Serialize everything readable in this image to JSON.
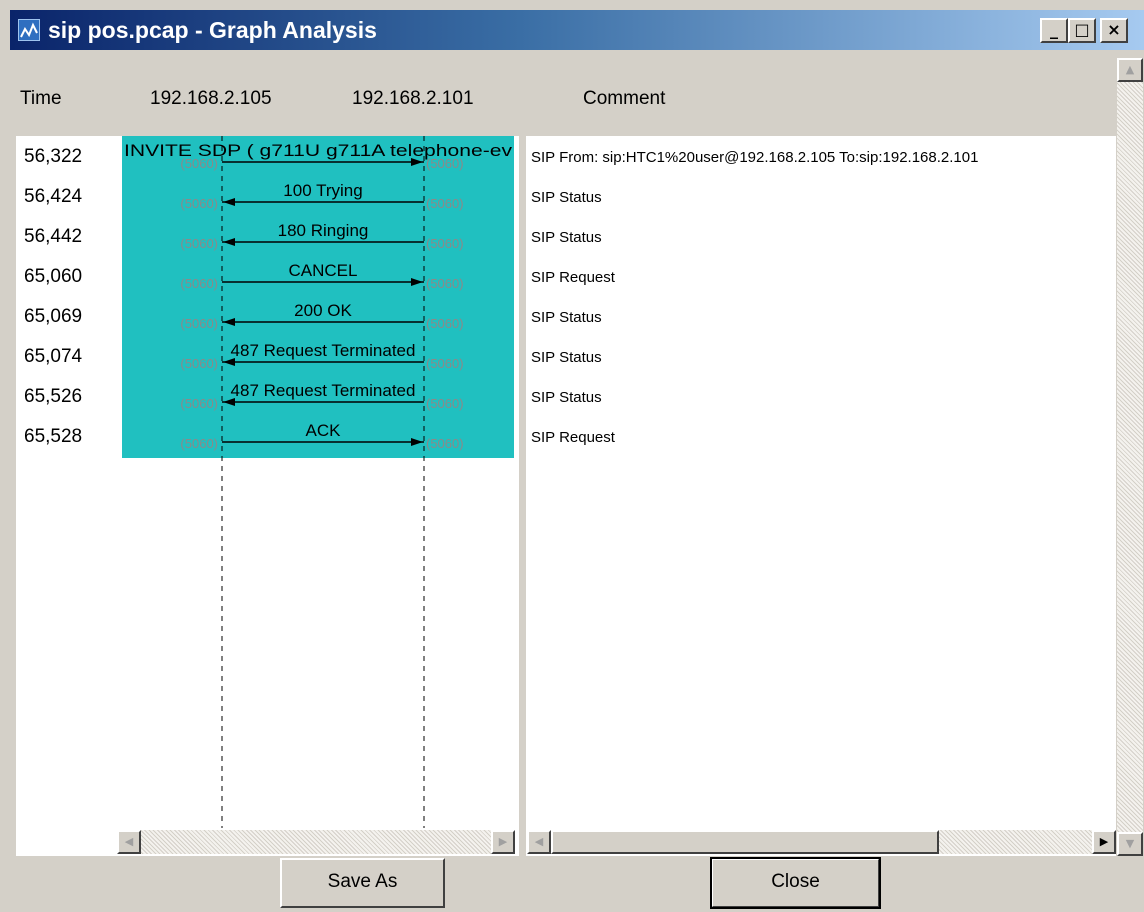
{
  "window": {
    "title": "sip pos.pcap - Graph Analysis",
    "controls": {
      "minimize": "_",
      "maximize": "□",
      "close": "×"
    }
  },
  "header": {
    "time": "Time",
    "host_a": "192.168.2.105",
    "host_b": "192.168.2.101",
    "comment": "Comment"
  },
  "colors": {
    "highlight": "#20c0c0",
    "titlebar": "#0a246a"
  },
  "rows": [
    {
      "time": "56,322",
      "label": "INVITE SDP ( g711U g711A telephone-ev",
      "direction": "right",
      "src_port": "(5060)",
      "dst_port": "(5060)",
      "comment": "SIP From: sip:HTC1%20user@192.168.2.105 To:sip:192.168.2.101"
    },
    {
      "time": "56,424",
      "label": "100 Trying",
      "direction": "left",
      "src_port": "(5060)",
      "dst_port": "(5060)",
      "comment": "SIP Status"
    },
    {
      "time": "56,442",
      "label": "180 Ringing",
      "direction": "left",
      "src_port": "(5060)",
      "dst_port": "(5060)",
      "comment": "SIP Status"
    },
    {
      "time": "65,060",
      "label": "CANCEL",
      "direction": "right",
      "src_port": "(5060)",
      "dst_port": "(5060)",
      "comment": "SIP Request"
    },
    {
      "time": "65,069",
      "label": "200 OK",
      "direction": "left",
      "src_port": "(5060)",
      "dst_port": "(5060)",
      "comment": "SIP Status"
    },
    {
      "time": "65,074",
      "label": "487 Request Terminated",
      "direction": "left",
      "src_port": "(5060)",
      "dst_port": "(5060)",
      "comment": "SIP Status"
    },
    {
      "time": "65,526",
      "label": "487 Request Terminated",
      "direction": "left",
      "src_port": "(5060)",
      "dst_port": "(5060)",
      "comment": "SIP Status"
    },
    {
      "time": "65,528",
      "label": "ACK",
      "direction": "right",
      "src_port": "(5060)",
      "dst_port": "(5060)",
      "comment": "SIP Request"
    }
  ],
  "buttons": {
    "save_as": "Save As",
    "save_as_mnemonic": "A",
    "close": "Close",
    "close_mnemonic": "C"
  },
  "scroll_arrows": {
    "left": "◀",
    "right": "▶",
    "up": "▲",
    "down": "▼"
  }
}
